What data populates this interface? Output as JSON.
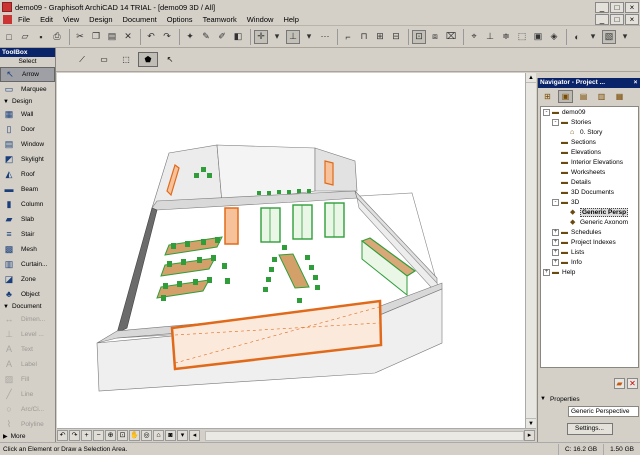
{
  "window": {
    "title": "demo09 - Graphisoft ArchiCAD 14 TRIAL - [demo09 3D / All]",
    "controls": [
      "_",
      "□",
      "×"
    ]
  },
  "menubar": {
    "items": [
      "File",
      "Edit",
      "View",
      "Design",
      "Document",
      "Options",
      "Teamwork",
      "Window",
      "Help"
    ],
    "doc_controls": [
      "_",
      "□",
      "×"
    ]
  },
  "toolbox": {
    "header": "ToolBox",
    "select_label": "Select",
    "tools_top": [
      {
        "label": "Arrow",
        "icon": "arrow-icon",
        "glyph": "↖",
        "active": true
      },
      {
        "label": "Marquee",
        "icon": "marquee-icon",
        "glyph": "▭",
        "active": false
      }
    ],
    "design_group": "Design",
    "design_tools": [
      {
        "label": "Wall",
        "icon": "wall-icon",
        "glyph": "▦"
      },
      {
        "label": "Door",
        "icon": "door-icon",
        "glyph": "▯"
      },
      {
        "label": "Window",
        "icon": "window-icon",
        "glyph": "▤"
      },
      {
        "label": "Skylight",
        "icon": "skylight-icon",
        "glyph": "◩"
      },
      {
        "label": "Roof",
        "icon": "roof-icon",
        "glyph": "◭"
      },
      {
        "label": "Beam",
        "icon": "beam-icon",
        "glyph": "▬"
      },
      {
        "label": "Column",
        "icon": "column-icon",
        "glyph": "▮"
      },
      {
        "label": "Slab",
        "icon": "slab-icon",
        "glyph": "▰"
      },
      {
        "label": "Stair",
        "icon": "stair-icon",
        "glyph": "≡"
      },
      {
        "label": "Mesh",
        "icon": "mesh-icon",
        "glyph": "▩"
      },
      {
        "label": "Curtain...",
        "icon": "curtain-wall-icon",
        "glyph": "▥"
      },
      {
        "label": "Zone",
        "icon": "zone-icon",
        "glyph": "◪"
      },
      {
        "label": "Object",
        "icon": "object-icon",
        "glyph": "♣"
      }
    ],
    "document_group": "Document",
    "document_tools": [
      {
        "label": "Dimen...",
        "icon": "dimension-icon",
        "glyph": "↔"
      },
      {
        "label": "Level ...",
        "icon": "level-dimension-icon",
        "glyph": "⊥"
      },
      {
        "label": "Text",
        "icon": "text-icon",
        "glyph": "A"
      },
      {
        "label": "Label",
        "icon": "label-icon",
        "glyph": "A"
      },
      {
        "label": "Fill",
        "icon": "fill-icon",
        "glyph": "▨"
      },
      {
        "label": "Line",
        "icon": "line-icon",
        "glyph": "╱"
      },
      {
        "label": "Arc/Ci...",
        "icon": "arc-circle-icon",
        "glyph": "○"
      },
      {
        "label": "Polyline",
        "icon": "polyline-icon",
        "glyph": "⌇"
      }
    ],
    "more_label": "More"
  },
  "navigator": {
    "header": "Navigator - Project ...",
    "tree": [
      {
        "label": "demo09",
        "level": 0,
        "expander": "-",
        "icon": "folder-icon"
      },
      {
        "label": "Stories",
        "level": 1,
        "expander": "-",
        "icon": "folder-icon"
      },
      {
        "label": "0. Story",
        "level": 2,
        "expander": "",
        "icon": "story-icon"
      },
      {
        "label": "Sections",
        "level": 1,
        "expander": "",
        "icon": "folder-icon"
      },
      {
        "label": "Elevations",
        "level": 1,
        "expander": "",
        "icon": "folder-icon"
      },
      {
        "label": "Interior Elevations",
        "level": 1,
        "expander": "",
        "icon": "folder-icon"
      },
      {
        "label": "Worksheets",
        "level": 1,
        "expander": "",
        "icon": "folder-icon"
      },
      {
        "label": "Details",
        "level": 1,
        "expander": "",
        "icon": "folder-icon"
      },
      {
        "label": "3D Documents",
        "level": 1,
        "expander": "",
        "icon": "folder-icon"
      },
      {
        "label": "3D",
        "level": 1,
        "expander": "-",
        "icon": "folder-icon"
      },
      {
        "label": "Generic Persp",
        "level": 2,
        "expander": "",
        "icon": "perspective-icon",
        "selected": true
      },
      {
        "label": "Generic Axonom",
        "level": 2,
        "expander": "",
        "icon": "axonometry-icon"
      },
      {
        "label": "Schedules",
        "level": 1,
        "expander": "+",
        "icon": "folder-icon"
      },
      {
        "label": "Project Indexes",
        "level": 1,
        "expander": "+",
        "icon": "folder-icon"
      },
      {
        "label": "Lists",
        "level": 1,
        "expander": "+",
        "icon": "folder-icon"
      },
      {
        "label": "Info",
        "level": 1,
        "expander": "+",
        "icon": "folder-icon"
      },
      {
        "label": "Help",
        "level": 0,
        "expander": "+",
        "icon": "folder-icon"
      }
    ],
    "properties_label": "Properties",
    "property_value": "Generic Perspective",
    "settings_label": "Settings..."
  },
  "statusbar": {
    "message": "Click an Element or Draw a Selection Area.",
    "disk": "C: 16.2 GB",
    "memory": "1.50 GB"
  },
  "colors": {
    "title_bar": "#0a246a",
    "accent_wall_orange": "#e06a1a",
    "furniture_green": "#2f9e3a",
    "floor": "#ffffff"
  }
}
